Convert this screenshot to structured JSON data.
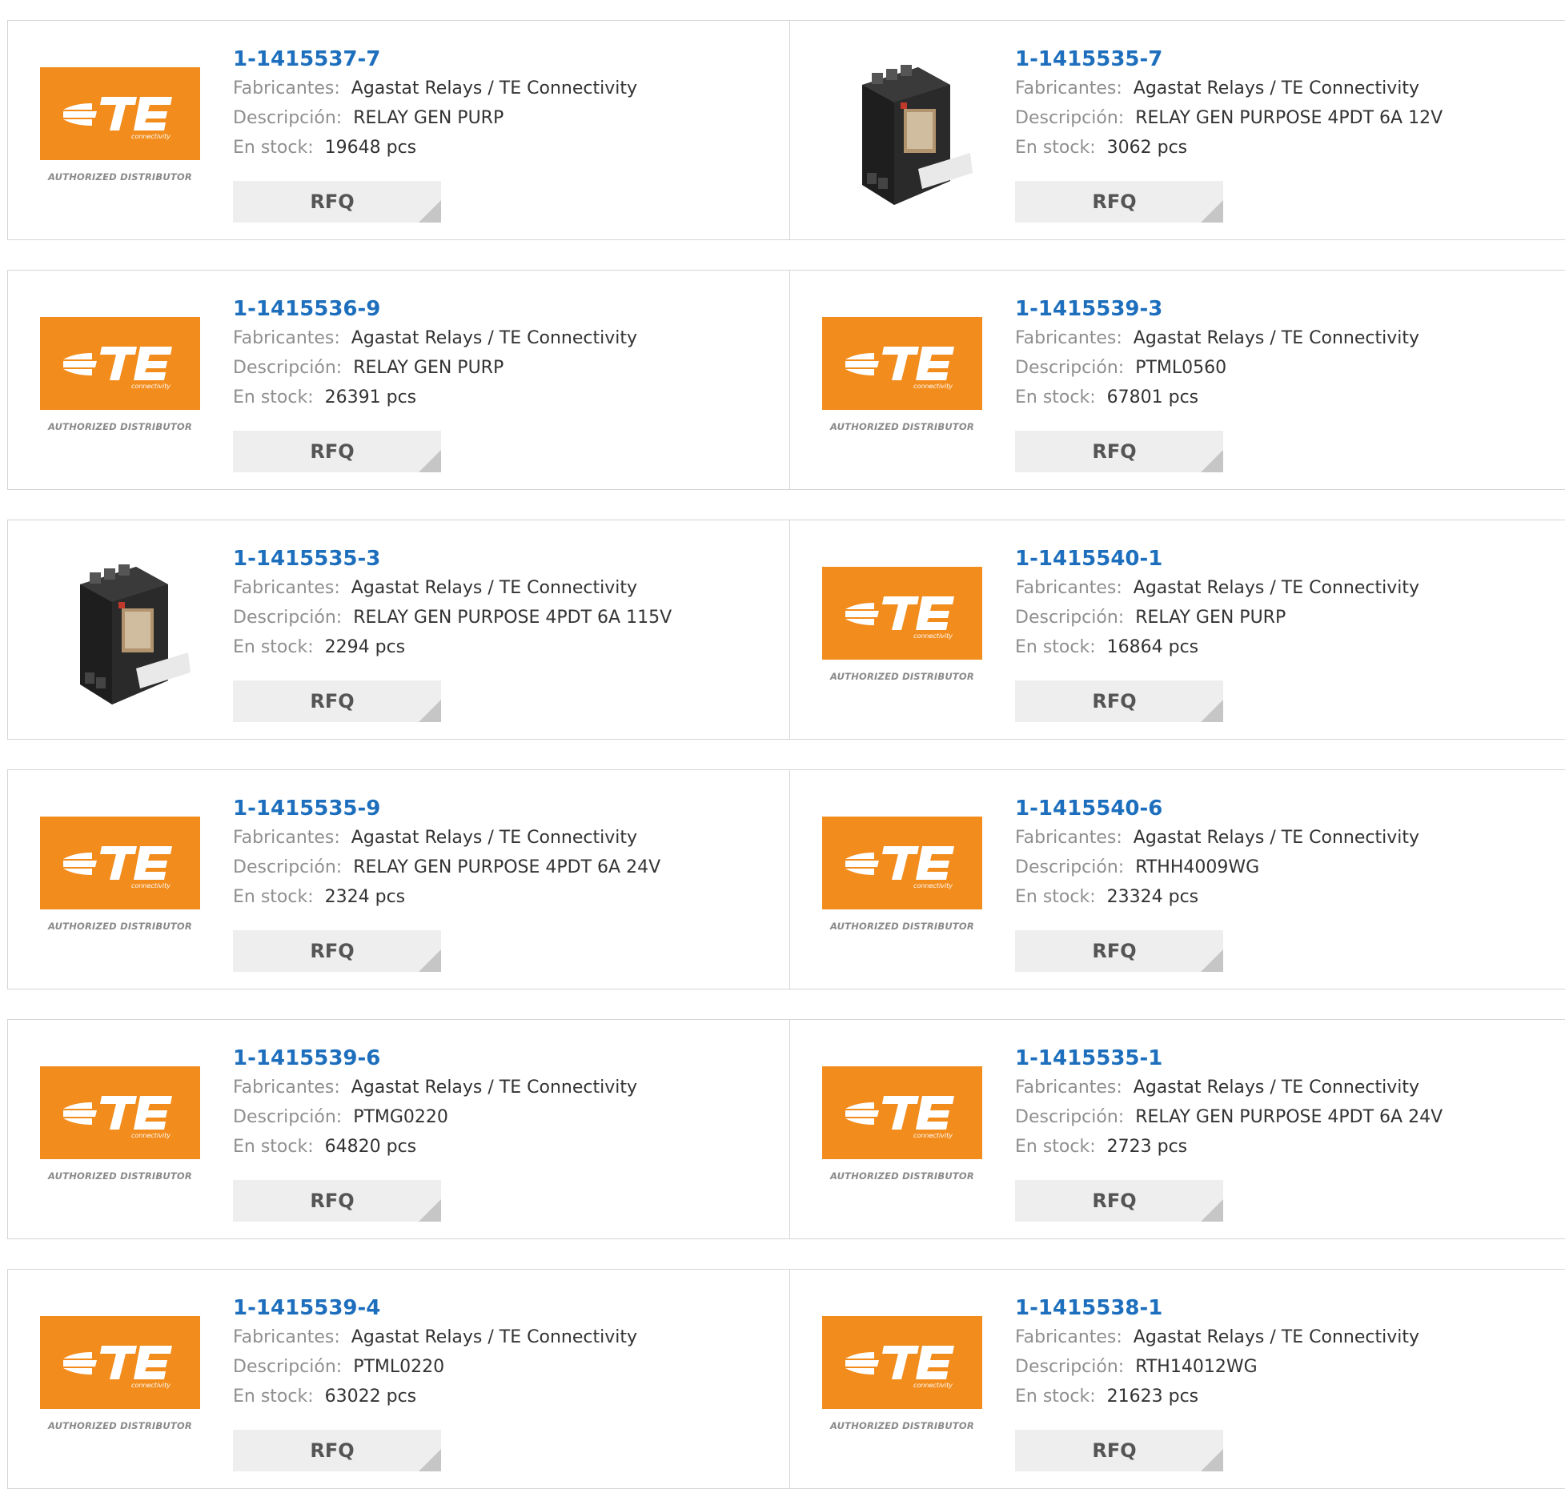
{
  "labels": {
    "manufacturer": "Fabricantes:",
    "description": "Descripción:",
    "stock": "En stock:",
    "rfq": "RFQ",
    "logo_text": "TE",
    "logo_sub": "connectivity",
    "authorized": "AUTHORIZED DISTRIBUTOR"
  },
  "colors": {
    "link": "#1d6fbd",
    "brand_orange": "#f28c1c",
    "label_gray": "#8f8f8f",
    "border": "#d6d6d6",
    "button_bg": "#eeeeee"
  },
  "products": [
    {
      "part": "1-1415537-7",
      "manufacturer": "Agastat Relays / TE Connectivity",
      "description": "RELAY GEN PURP",
      "stock": "19648 pcs",
      "image": "te-logo"
    },
    {
      "part": "1-1415535-7",
      "manufacturer": "Agastat Relays / TE Connectivity",
      "description": "RELAY GEN PURPOSE 4PDT 6A 12V",
      "stock": "3062 pcs",
      "image": "relay-photo"
    },
    {
      "part": "1-1415536-9",
      "manufacturer": "Agastat Relays / TE Connectivity",
      "description": "RELAY GEN PURP",
      "stock": "26391 pcs",
      "image": "te-logo"
    },
    {
      "part": "1-1415539-3",
      "manufacturer": "Agastat Relays / TE Connectivity",
      "description": "PTML0560",
      "stock": "67801 pcs",
      "image": "te-logo"
    },
    {
      "part": "1-1415535-3",
      "manufacturer": "Agastat Relays / TE Connectivity",
      "description": "RELAY GEN PURPOSE 4PDT 6A 115V",
      "stock": "2294 pcs",
      "image": "relay-photo"
    },
    {
      "part": "1-1415540-1",
      "manufacturer": "Agastat Relays / TE Connectivity",
      "description": "RELAY GEN PURP",
      "stock": "16864 pcs",
      "image": "te-logo"
    },
    {
      "part": "1-1415535-9",
      "manufacturer": "Agastat Relays / TE Connectivity",
      "description": "RELAY GEN PURPOSE 4PDT 6A 24V",
      "stock": "2324 pcs",
      "image": "te-logo"
    },
    {
      "part": "1-1415540-6",
      "manufacturer": "Agastat Relays / TE Connectivity",
      "description": "RTHH4009WG",
      "stock": "23324 pcs",
      "image": "te-logo"
    },
    {
      "part": "1-1415539-6",
      "manufacturer": "Agastat Relays / TE Connectivity",
      "description": "PTMG0220",
      "stock": "64820 pcs",
      "image": "te-logo"
    },
    {
      "part": "1-1415535-1",
      "manufacturer": "Agastat Relays / TE Connectivity",
      "description": "RELAY GEN PURPOSE 4PDT 6A 24V",
      "stock": "2723 pcs",
      "image": "te-logo"
    },
    {
      "part": "1-1415539-4",
      "manufacturer": "Agastat Relays / TE Connectivity",
      "description": "PTML0220",
      "stock": "63022 pcs",
      "image": "te-logo"
    },
    {
      "part": "1-1415538-1",
      "manufacturer": "Agastat Relays / TE Connectivity",
      "description": "RTH14012WG",
      "stock": "21623 pcs",
      "image": "te-logo"
    }
  ]
}
